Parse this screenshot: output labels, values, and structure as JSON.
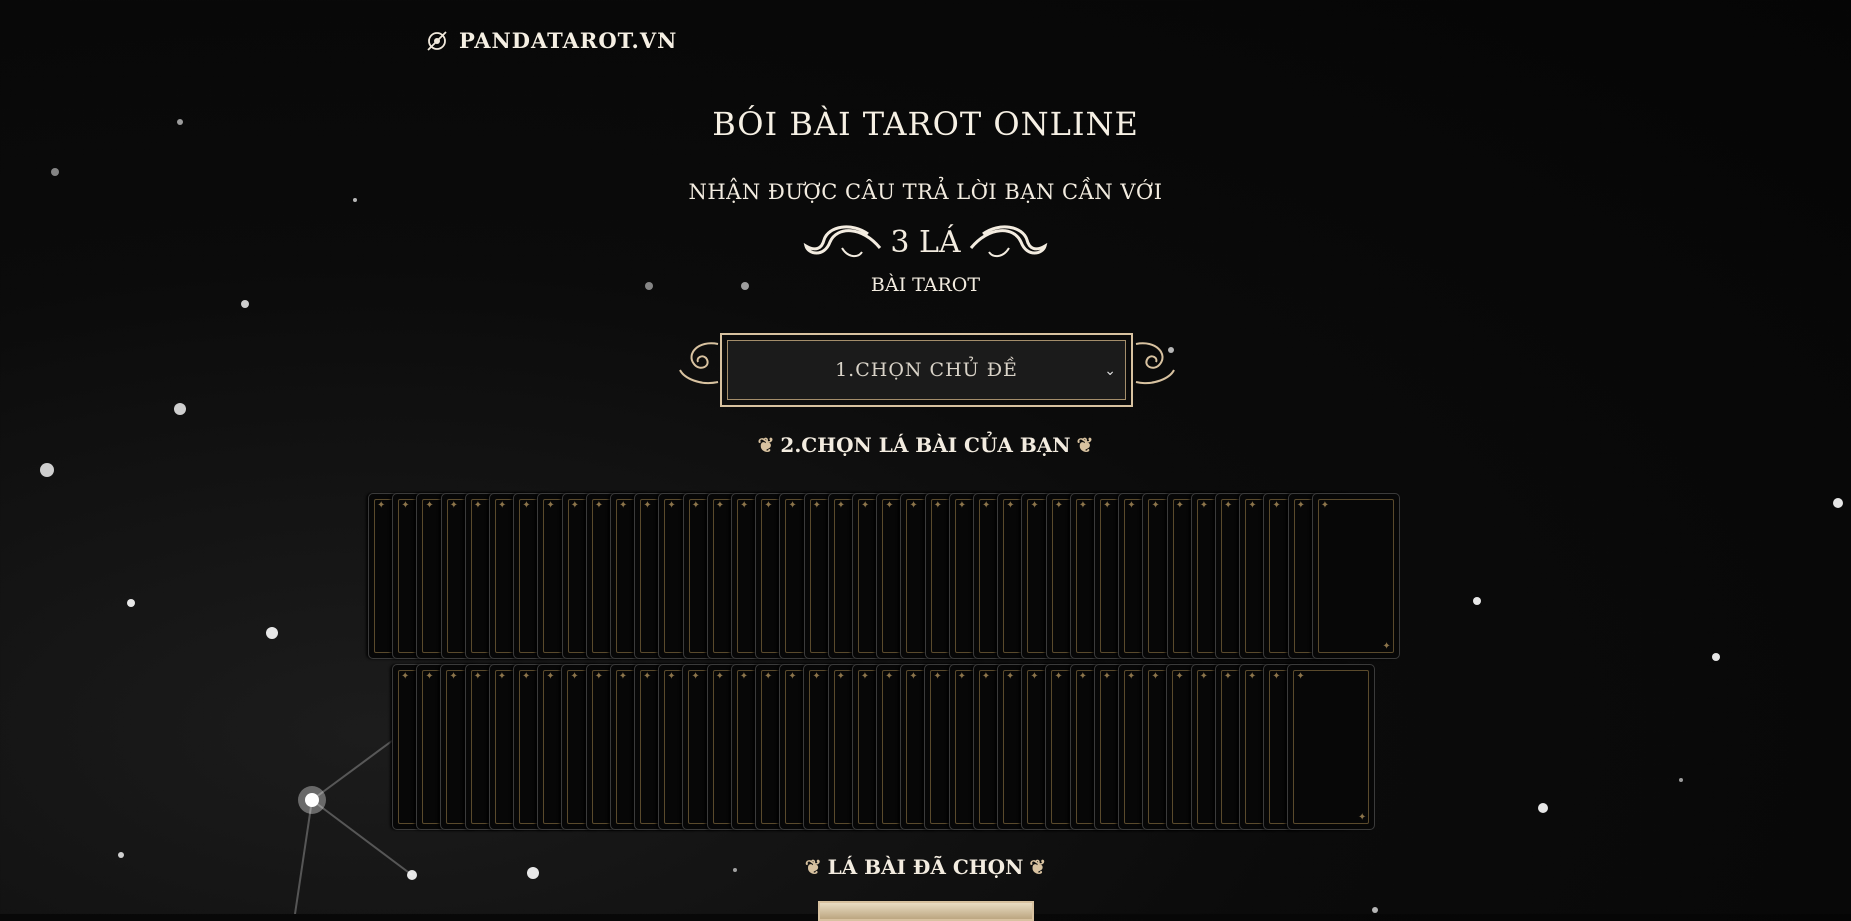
{
  "site": {
    "logo_text": "PANDATAROT.VN"
  },
  "hero": {
    "title": "BÓI BÀI TAROT ONLINE",
    "subtitle": "NHẬN ĐƯỢC CÂU TRẢ LỜI BẠN CẦN VỚI",
    "count_text": "3 LÁ",
    "subtitle_end": "BÀI TAROT"
  },
  "topic_select": {
    "selected": "1.CHỌN CHỦ ĐỀ"
  },
  "step2": {
    "label": "2.CHỌN LÁ BÀI CỦA BẠN"
  },
  "deck": {
    "row1_count": 40,
    "row2_count": 38
  },
  "selected_section": {
    "label": "LÁ BÀI ĐÃ CHỌN"
  },
  "colors": {
    "accent_gold": "#d8c2a0",
    "background": "#050505"
  }
}
